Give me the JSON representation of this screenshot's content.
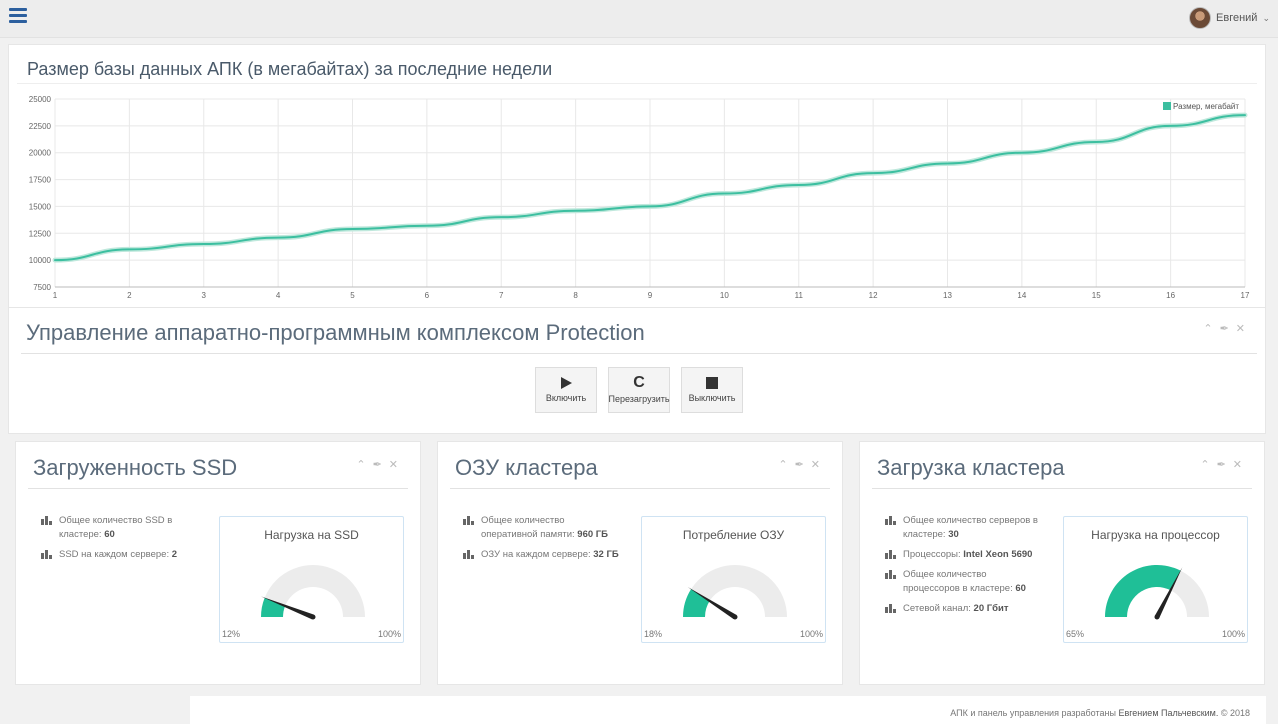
{
  "header": {
    "user_name": "Евгений"
  },
  "db_chart": {
    "title": "Размер базы данных АПК (в мегабайтах) за последние недели"
  },
  "chart_data": {
    "type": "line",
    "title": "Размер базы данных АПК (в мегабайтах) за последние недели",
    "x": [
      1,
      2,
      3,
      4,
      5,
      6,
      7,
      8,
      9,
      10,
      11,
      12,
      13,
      14,
      15,
      16,
      17
    ],
    "series": [
      {
        "name": "Размер, мегабайт",
        "color": "#3cbfa0",
        "values": [
          10000,
          11000,
          11500,
          12100,
          12900,
          13200,
          14000,
          14600,
          15000,
          16200,
          17000,
          18100,
          19000,
          20000,
          21000,
          22500,
          23500
        ]
      }
    ],
    "ylim": [
      7500,
      25000
    ],
    "yticks": [
      7500,
      10000,
      12500,
      15000,
      17500,
      20000,
      22500,
      25000
    ],
    "grid": true,
    "legend": "top-right"
  },
  "control": {
    "title": "Управление аппаратно-программным комплексом  Protection",
    "buttons": [
      {
        "icon": "play-icon",
        "label": "Включить"
      },
      {
        "icon": "restart-icon",
        "label": "Перезагрузить"
      },
      {
        "icon": "stop-icon",
        "label": "Выключить"
      }
    ]
  },
  "cards": [
    {
      "title": "Загруженность SSD",
      "info": [
        {
          "text": "Общее количество SSD в кластере: ",
          "value": "60"
        },
        {
          "text": "SSD на каждом сервере: ",
          "value": "2"
        }
      ],
      "gauge": {
        "title": "Нагрузка на SSD",
        "value": 12,
        "min_label": "12%",
        "max_label": "100%"
      }
    },
    {
      "title": "ОЗУ кластера",
      "info": [
        {
          "text": "Общее количество оперативной памяти: ",
          "value": "960 ГБ"
        },
        {
          "text": "ОЗУ на каждом сервере: ",
          "value": "32 ГБ"
        }
      ],
      "gauge": {
        "title": "Потребление ОЗУ",
        "value": 18,
        "min_label": "18%",
        "max_label": "100%"
      }
    },
    {
      "title": "Загрузка кластера",
      "info": [
        {
          "text": "Общее количество серверов в кластере: ",
          "value": "30"
        },
        {
          "text": "Процессоры: ",
          "value": "Intel Xeon 5690"
        },
        {
          "text": "Общее количество процессоров в кластере: ",
          "value": "60"
        },
        {
          "text": "Сетевой канал: ",
          "value": "20 Гбит"
        }
      ],
      "gauge": {
        "title": "Нагрузка на процессор",
        "value": 65,
        "min_label": "65%",
        "max_label": "100%"
      }
    }
  ],
  "colors": {
    "accent": "#1fbf97",
    "gauge_bg": "#ececec",
    "needle": "#222222"
  },
  "footer": {
    "prefix": "АПК и панель управления разработаны ",
    "author": "Евгением Пальчевским.",
    "suffix": " © 2018"
  }
}
